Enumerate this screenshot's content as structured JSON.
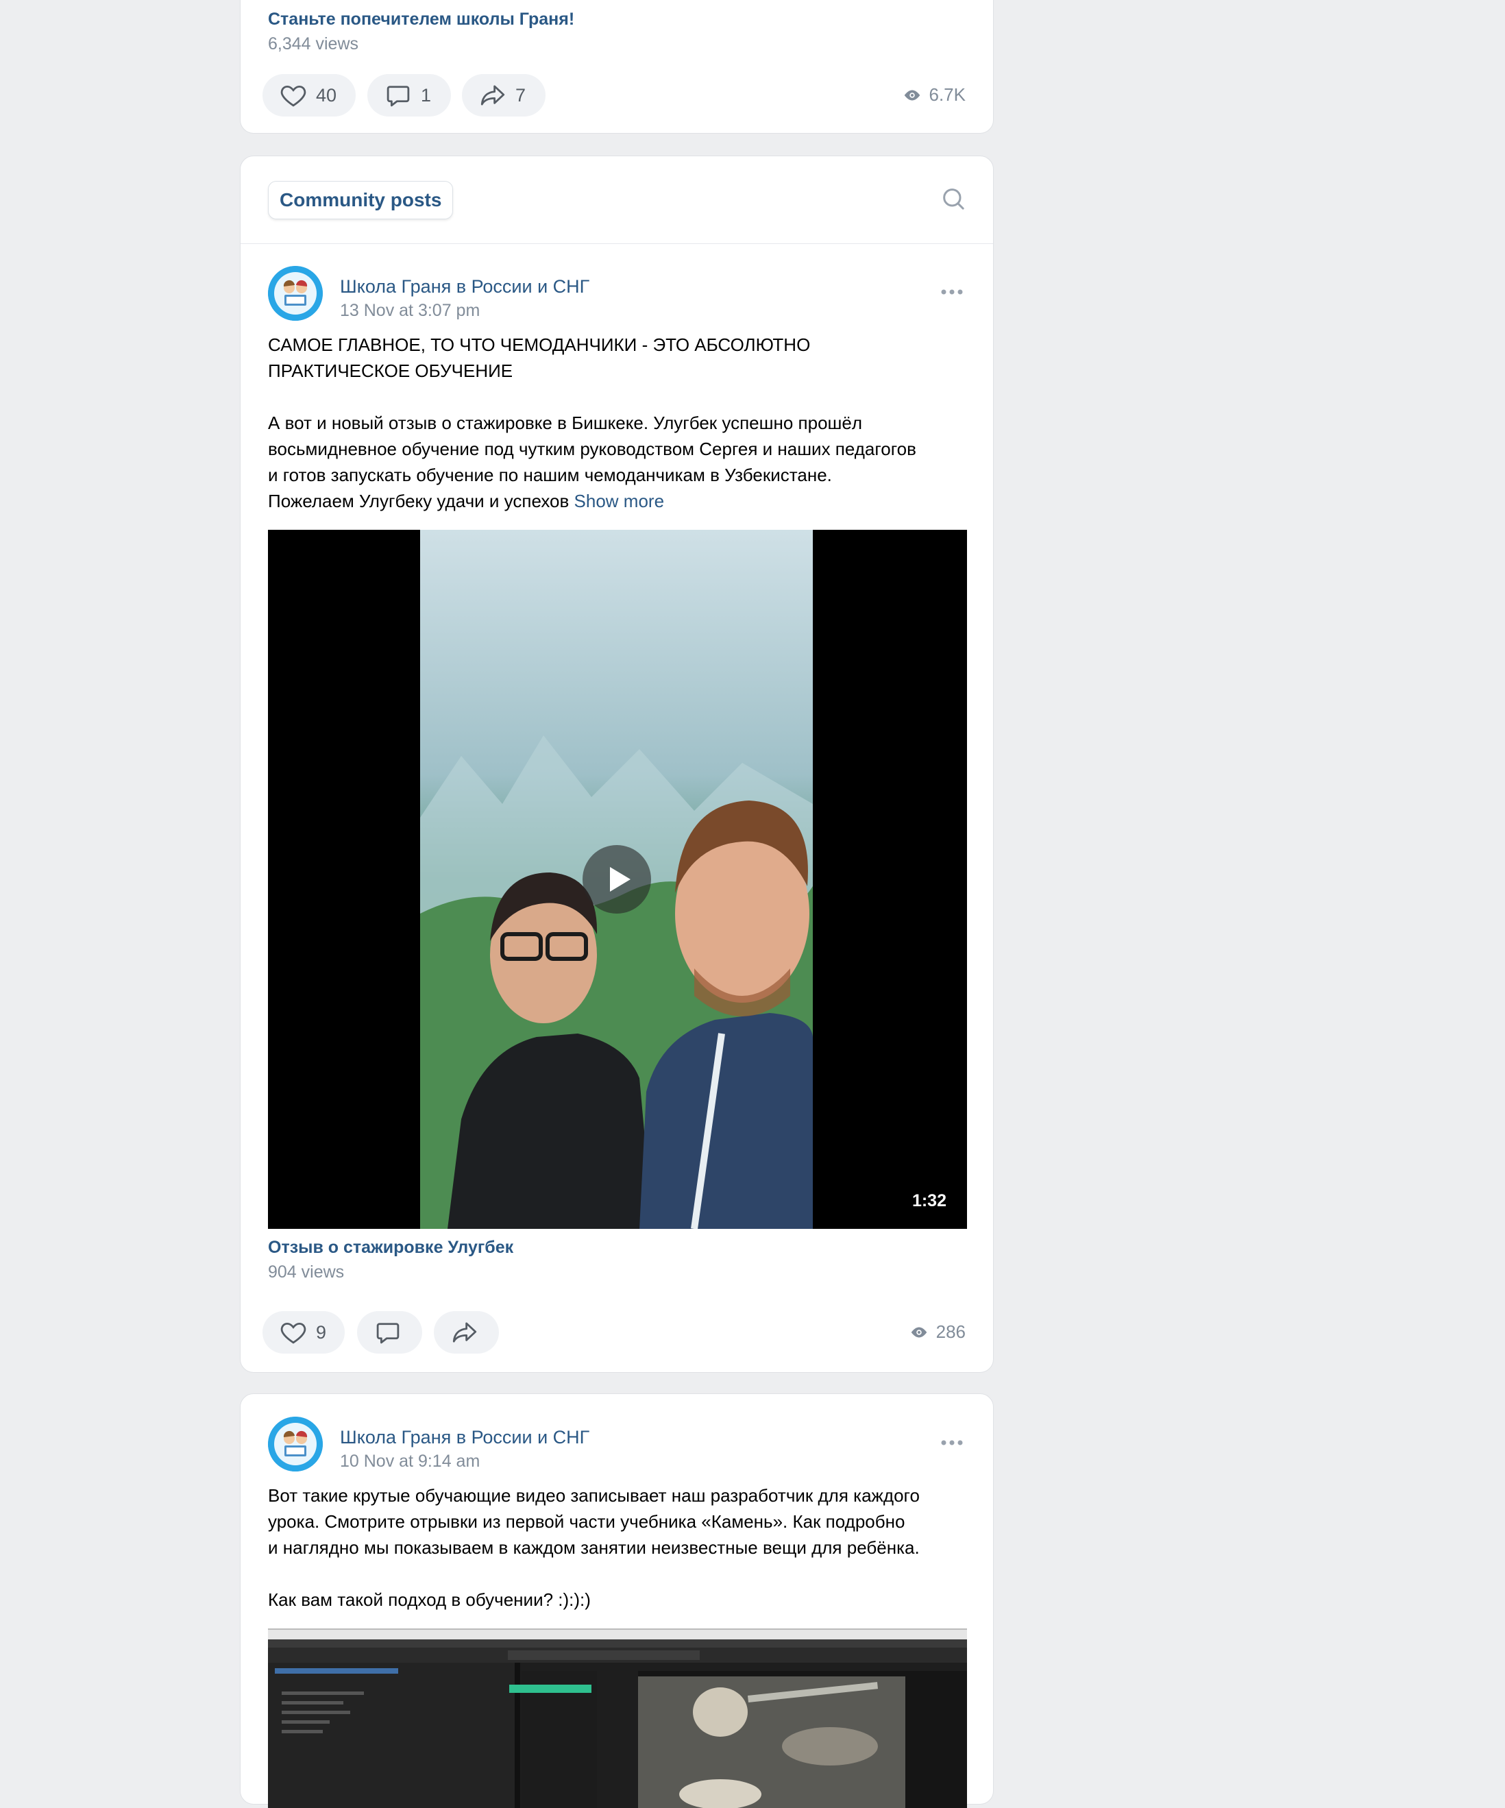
{
  "colors": {
    "accent": "#2a5885",
    "muted": "#818c99",
    "background": "#edeef0",
    "avatar": "#29a6e6"
  },
  "post_prev": {
    "link_title": "Станьте попечителем школы Граня!",
    "link_views": "6,344 views",
    "likes": "40",
    "comments": "1",
    "shares": "7",
    "views": "6.7K"
  },
  "community": {
    "tab_label": "Community posts",
    "search_icon": "search-icon"
  },
  "post1": {
    "author": "Школа Граня в России и СНГ",
    "date": "13 Nov at 3:07 pm",
    "text": "САМОЕ ГЛАВНОЕ, ТО ЧТО ЧЕМОДАНЧИКИ - ЭТО АБСОЛЮТНО\nПРАКТИЧЕСКОЕ ОБУЧЕНИЕ\n\nА вот и новый отзыв о стажировке в Бишкеке. Улугбек успешно прошёл\nвосьмидневное обучение под чутким руководством Сергея и наших педагогов\nи готов запускать обучение по нашим чемоданчикам в Узбекистане.\nПожелаем Улугбеку удачи и успехов ",
    "show_more": "Show more",
    "video_duration": "1:32",
    "video_title": "Отзыв о стажировке Улугбек",
    "video_views": "904 views",
    "likes": "9",
    "views": "286"
  },
  "post2": {
    "author": "Школа Граня в России и СНГ",
    "date": "10 Nov at 9:14 am",
    "text": "Вот такие крутые обучающие видео записывает наш разработчик для каждого\nурока. Смотрите отрывки из первой части учебника «Камень». Как подробно\nи наглядно мы показываем в каждом занятии неизвестные вещи для ребёнка.\n\nКак вам такой подход в обучении? :):):)"
  }
}
